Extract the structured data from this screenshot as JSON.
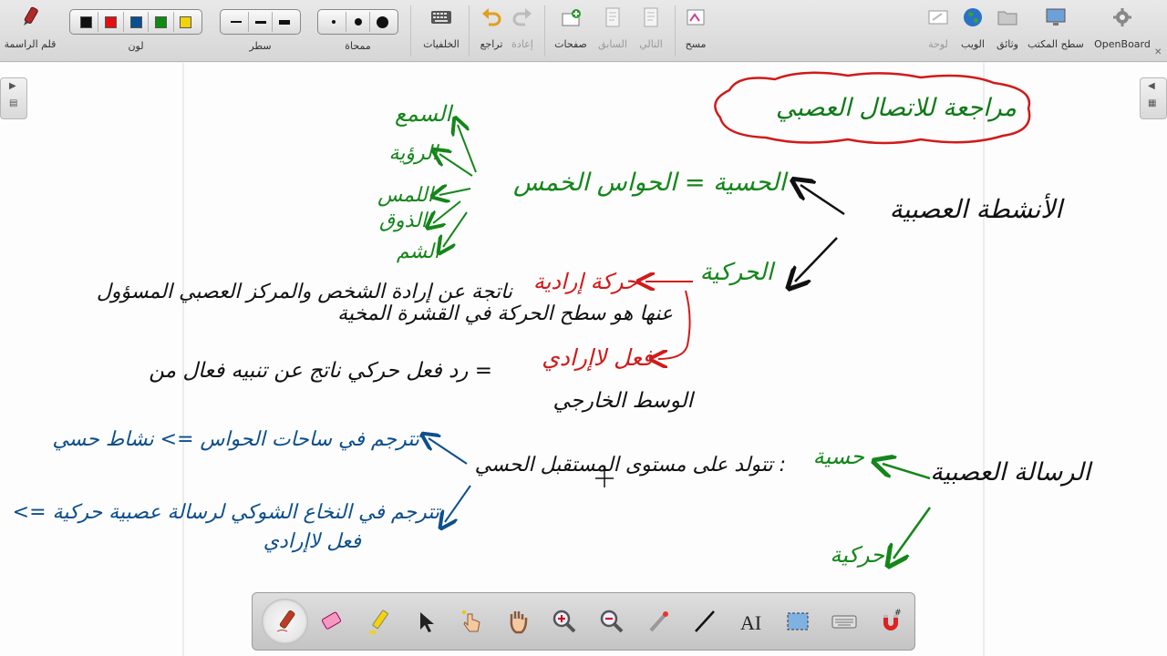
{
  "toolbar": {
    "openboard": "OpenBoard",
    "desktop": "سطح المكتب",
    "documents": "وثائق",
    "web": "الويب",
    "board": "لوحة",
    "erase": "مسح",
    "next": "التالي",
    "previous": "السابق",
    "pages": "صفحات",
    "redo": "إعادة",
    "undo": "تراجع",
    "backgrounds": "الخلفيات",
    "eraser_size": "ممحاة",
    "line_width": "سطر",
    "color": "لون",
    "pen": "قلم الراسمة"
  },
  "colors": {
    "black": "#111111",
    "red": "#e01010",
    "blue": "#0a4f8f",
    "green": "#118a11",
    "yellow": "#f2d20a",
    "ink_red": "#d11a1a",
    "ink_green": "#14861a",
    "ink_blue": "#0d4f8b",
    "ink_black": "#111111"
  },
  "board": {
    "title_cloud": "مراجعة للاتصال العصبي",
    "neural_activities": "الأنشطة العصبية",
    "sensory_eq": "الحسية = الحواس الخمس",
    "hearing": "السمع",
    "sight": "الرؤية",
    "touch": "اللمس",
    "taste": "الذوق",
    "smell": "الشم",
    "motor": "الحركية",
    "voluntary": "حركة إرادية",
    "voluntary_desc_1": "ناتجة عن إرادة الشخص والمركز العصبي المسؤول",
    "voluntary_desc_2": "عنها هو سطح الحركة في القشرة المخية",
    "reflex": "فعل لاإرادي",
    "reflex_desc": "= رد فعل حركي ناتج عن تنبيه فعال من",
    "reflex_desc_2": "الوسط الخارجي",
    "nerve_message": "الرسالة العصبية",
    "sensory": "حسية",
    "generated": ": تتولد على مستوى المستقبل الحسي",
    "translated_1": "تترجم في ساحات الحواس => نشاط حسي",
    "translated_2": "تترجم في النخاع الشوكي لرسالة عصبية حركية =>",
    "reflex_short": "فعل لاإرادي",
    "motor_short": "حركية"
  },
  "bottom_tools": [
    "pen-tool",
    "eraser-tool",
    "marker-tool",
    "selector-tool",
    "interact-tool",
    "hand-tool",
    "zoom-in-tool",
    "zoom-out-tool",
    "laser-pointer-tool",
    "line-tool",
    "text-tool",
    "capture-tool",
    "keyboard-tool",
    "magnet-tool"
  ]
}
